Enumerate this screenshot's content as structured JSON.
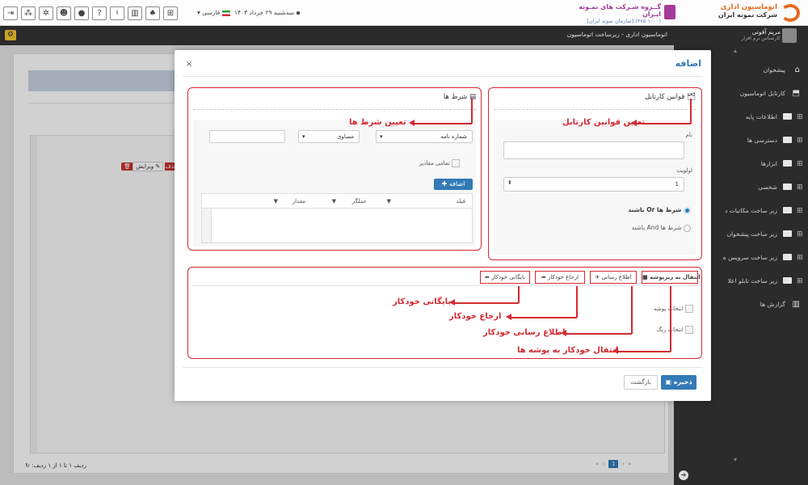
{
  "colors": {
    "accent": "#337ab7",
    "annotation_red": "#d42a32",
    "dark_bar": "#2b2b2b",
    "delete_red": "#c9302c"
  },
  "topbar": {
    "brand_group": "گــروه شـرکت های نمـونه ایـران",
    "brand_sub": "(۱۰۰۰ ۴۷۵) [سازمان نمونه ایران]",
    "company_title": "اتوماسیون اداری",
    "company_name": "شرکت نمونه ایران",
    "date": "سه‌شنبه ۲۹ خرداد ۱۴۰۳",
    "language": "فارسی",
    "icons": [
      "logout-icon",
      "sitemap-icon",
      "settings-icon",
      "users-icon",
      "chat-icon",
      "help-icon",
      "microphone-icon",
      "chart-icon",
      "bell-icon",
      "network-icon"
    ]
  },
  "userbar": {
    "user_name": "مریم آقوتی",
    "user_role": "کارشناس نرم افزار",
    "breadcrumb": "اتوماسیون اداری - زیرساخت اتوماسیون"
  },
  "sidebar": {
    "items": [
      {
        "label": "پیشخوان",
        "icon": "home-icon"
      },
      {
        "label": "کارتابل اتوماسیون",
        "icon": "inbox-icon"
      },
      {
        "label": "اطلاعات پایه",
        "icon": "folder-icon"
      },
      {
        "label": "دسترسی ها",
        "icon": "folder-icon"
      },
      {
        "label": "ابزارها",
        "icon": "folder-icon"
      },
      {
        "label": "شخصی",
        "icon": "folder-icon"
      },
      {
        "label": "زیر ساخت مکاتبات د",
        "icon": "folder-icon"
      },
      {
        "label": "زیر ساخت پیشخوان",
        "icon": "folder-icon"
      },
      {
        "label": "زیر ساخت سرویس ه",
        "icon": "folder-icon"
      },
      {
        "label": "زیر ساخت تابلو اعلا",
        "icon": "folder-icon"
      },
      {
        "label": "گزارش ها",
        "icon": "report-icon"
      }
    ]
  },
  "background": {
    "edit_label": "ویرایش",
    "delete_label": "حذف",
    "pager_info": "ردیف ۱ تا ۱ از ۱ ردیف:",
    "page_current": "1"
  },
  "modal": {
    "title": "اضافه",
    "close": "×",
    "rules_panel": {
      "title": "قوانین کارتابل",
      "name_label": "نام",
      "name_value": "",
      "priority_label": "اولویت",
      "priority_value": "1",
      "radio_or": "شرط ها Or باشند",
      "radio_and": "شرط ها And باشند"
    },
    "conditions_panel": {
      "title": "شرط ها",
      "field_select": "شماره نامه",
      "operator_select": "مساوی",
      "value_input": "",
      "all_values_label": "تمامی مقادیر",
      "add_button": "اضافه",
      "columns": [
        "فیلد",
        "عملگر",
        "مقدار"
      ]
    },
    "actions_panel": {
      "tabs": [
        "انتقال به زیرپوشه",
        "اطلاع رسانی",
        "ارجاع خودکار",
        "بایگانی خودکار"
      ],
      "folder_select_label": "انتخاب پوشه",
      "color_select_label": "انتخاب رنگ"
    },
    "save_button": "ذخیره",
    "back_button": "بازگشت"
  },
  "annotations": {
    "rules": "تعیین قوانین کارتابل",
    "conditions": "تعیین شرط ها",
    "auto_archive": "بایگانی خودکار",
    "auto_refer": "ارجاع خودکار",
    "notify": "اطلاع رسانی خودکار",
    "auto_move": "انتقال خودکار به پوشه ها"
  }
}
